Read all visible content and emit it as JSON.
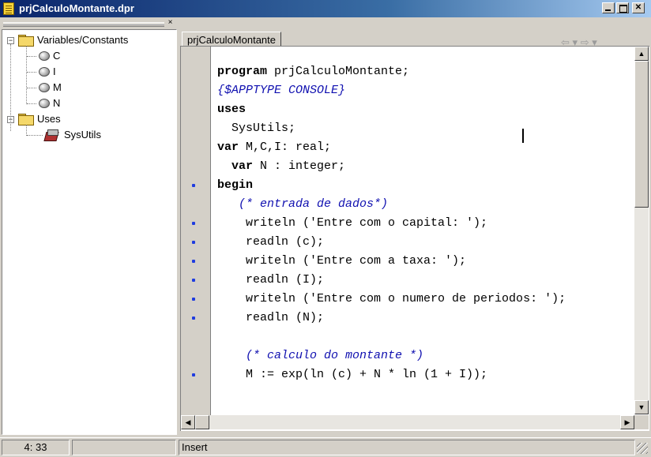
{
  "window": {
    "title": "prjCalculoMontante.dpr"
  },
  "tree": {
    "close_glyph": "×",
    "groups": [
      {
        "label": "Variables/Constants",
        "expander": "−",
        "items": [
          "C",
          "I",
          "M",
          "N"
        ]
      },
      {
        "label": "Uses",
        "expander": "−",
        "items": [
          "SysUtils"
        ]
      }
    ]
  },
  "tabs": [
    {
      "label": "prjCalculoMontante"
    }
  ],
  "editor": {
    "lines": [
      [
        {
          "t": "program",
          "k": "kw"
        },
        {
          "t": " prjCalculoMontante;"
        }
      ],
      [
        {
          "t": "{$APPTYPE CONSOLE}",
          "k": "cm"
        }
      ],
      [
        {
          "t": "uses",
          "k": "kw"
        }
      ],
      [
        {
          "t": "  SysUtils;"
        }
      ],
      [
        {
          "t": "var",
          "k": "kw"
        },
        {
          "t": " M,C,I: real;"
        }
      ],
      [
        {
          "t": "  "
        },
        {
          "t": "var",
          "k": "kw"
        },
        {
          "t": " N : integer;"
        }
      ],
      [
        {
          "t": "begin",
          "k": "kw"
        }
      ],
      [
        {
          "t": "   "
        },
        {
          "t": "(* entrada de dados*)",
          "k": "cm"
        }
      ],
      [
        {
          "t": "    writeln ('Entre com o capital: ');"
        }
      ],
      [
        {
          "t": "    readln (c);"
        }
      ],
      [
        {
          "t": "    writeln ('Entre com a taxa: ');"
        }
      ],
      [
        {
          "t": "    readln (I);"
        }
      ],
      [
        {
          "t": "    writeln ('Entre com o numero de periodos: ');"
        }
      ],
      [
        {
          "t": "    readln (N);"
        }
      ],
      [
        {
          "t": ""
        }
      ],
      [
        {
          "t": "    "
        },
        {
          "t": "(* calculo do montante *)",
          "k": "cm"
        }
      ],
      [
        {
          "t": "    M := exp(ln (c) + N * ln (1 + I));"
        }
      ]
    ],
    "breakpoint_lines": [
      6,
      8,
      9,
      10,
      11,
      12,
      13,
      16
    ]
  },
  "nav": {
    "back_glyph": "⇦",
    "fwd_glyph": "⇨",
    "drop_glyph": "▾"
  },
  "status": {
    "position": "4:  33",
    "modified": "",
    "mode": "Insert"
  }
}
